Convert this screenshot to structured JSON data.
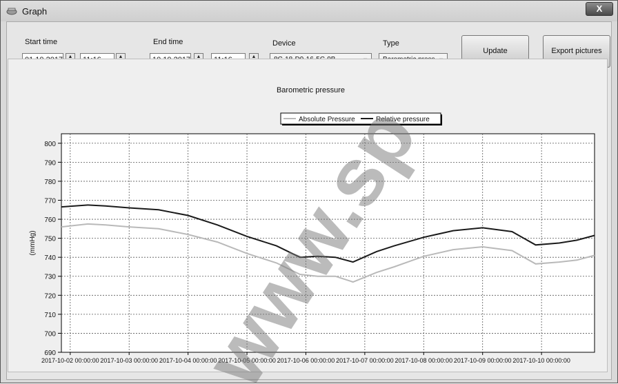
{
  "window": {
    "title": "Graph",
    "close_label": "X"
  },
  "controls": {
    "start_time": {
      "label": "Start time",
      "date": "01.10.2017",
      "time": "11:16"
    },
    "end_time": {
      "label": "End time",
      "date": "10.10.2017",
      "time": "11:16"
    },
    "device": {
      "label": "Device",
      "value": "8C-18-D9-16-5C-9B"
    },
    "type": {
      "label": "Type",
      "value": "Barometric press"
    },
    "update_label": "Update",
    "export_label": "Export pictures"
  },
  "chart_data": {
    "type": "line",
    "title": "Barometric pressure",
    "ylabel": "(mmHg)",
    "xlabel": "",
    "ylim": [
      690,
      805
    ],
    "yticks": [
      690,
      700,
      710,
      720,
      730,
      740,
      750,
      760,
      770,
      780,
      790,
      800
    ],
    "xlim": [
      -0.15,
      8.9
    ],
    "xtick_positions": [
      0,
      1,
      2,
      3,
      4,
      5,
      6,
      7,
      8
    ],
    "xtick_labels": [
      "2017-10-02 00:00:00",
      "2017-10-03 00:00:00",
      "2017-10-04 00:00:00",
      "2017-10-05 00:00:00",
      "2017-10-06 00:00:00",
      "2017-10-07 00:00:00",
      "2017-10-08 00:00:00",
      "2017-10-09 00:00:00",
      "2017-10-10 00:00:00"
    ],
    "legend_position": "top-center",
    "grid": true,
    "series": [
      {
        "name": "Absolute Pressure",
        "color": "#b9b9b9",
        "x": [
          -0.15,
          0.3,
          0.6,
          1.0,
          1.5,
          2.0,
          2.5,
          3.0,
          3.5,
          3.9,
          4.2,
          4.5,
          4.8,
          5.2,
          5.5,
          6.0,
          6.5,
          7.0,
          7.5,
          7.9,
          8.3,
          8.6,
          8.9
        ],
        "y": [
          756,
          757.5,
          757,
          756,
          755,
          752,
          748,
          742,
          737,
          731,
          730,
          730,
          727,
          732,
          735,
          740.5,
          744,
          745.5,
          743.5,
          736.5,
          737.5,
          738.5,
          741
        ]
      },
      {
        "name": "Relative pressure",
        "color": "#1a1a1a",
        "x": [
          -0.15,
          0.3,
          0.6,
          1.0,
          1.5,
          2.0,
          2.5,
          3.0,
          3.5,
          3.9,
          4.2,
          4.5,
          4.8,
          5.2,
          5.5,
          6.0,
          6.5,
          7.0,
          7.5,
          7.9,
          8.3,
          8.6,
          8.9
        ],
        "y": [
          766.5,
          767.5,
          767,
          766,
          765,
          762,
          757,
          751,
          746,
          740,
          740.5,
          740,
          737.5,
          743,
          746,
          750.5,
          754,
          755.5,
          753.5,
          746.5,
          747.5,
          749,
          751.5
        ]
      }
    ]
  },
  "watermark": {
    "text": "www.sp"
  }
}
